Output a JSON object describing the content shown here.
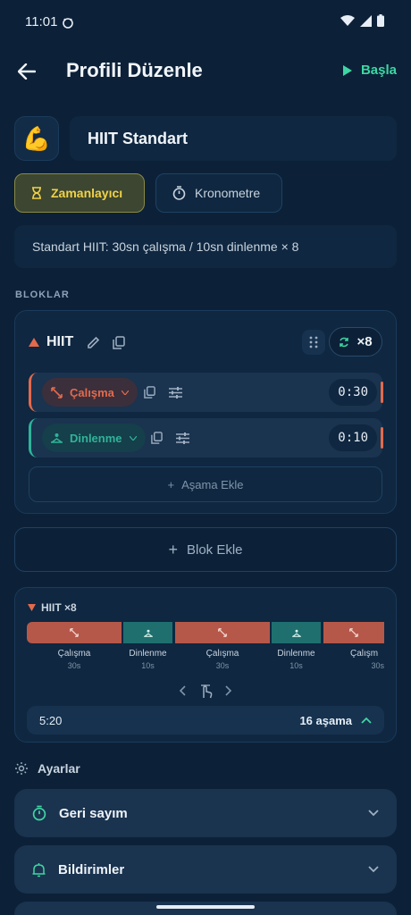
{
  "status": {
    "time": "11:01"
  },
  "header": {
    "title": "Profili Düzenle",
    "start_label": "Başla"
  },
  "profile": {
    "emoji": "💪",
    "name": "HIIT Standart",
    "description": "Standart HIIT: 30sn çalışma / 10sn dinlenme × 8"
  },
  "modes": {
    "timer": "Zamanlayıcı",
    "stopwatch": "Kronometre"
  },
  "section_blocks": "BLOKLAR",
  "block": {
    "name": "HIIT",
    "repeat": "×8",
    "phases": [
      {
        "label": "Çalışma",
        "time": "0:30",
        "type": "work"
      },
      {
        "label": "Dinlenme",
        "time": "0:10",
        "type": "rest"
      }
    ],
    "add_phase": "Aşama Ekle"
  },
  "add_block": "Blok Ekle",
  "preview": {
    "title": "HIIT ×8",
    "segments": [
      {
        "label": "Çalışma",
        "duration": "30s",
        "type": "work"
      },
      {
        "label": "Dinlenme",
        "duration": "10s",
        "type": "rest"
      },
      {
        "label": "Çalışma",
        "duration": "30s",
        "type": "work"
      },
      {
        "label": "Dinlenme",
        "duration": "10s",
        "type": "rest"
      },
      {
        "label": "Çalışm",
        "duration": "30s",
        "type": "work"
      }
    ],
    "total_time": "5:20",
    "phase_count": "16 aşama"
  },
  "settings": {
    "label": "Ayarlar",
    "items": [
      {
        "label": "Geri sayım",
        "icon": "stopwatch-icon"
      },
      {
        "label": "Bildirimler",
        "icon": "bell-icon"
      }
    ]
  },
  "colors": {
    "work": "#b5584a",
    "rest": "#1f6f6f",
    "accent": "#3ed6a3",
    "timer": "#f0d24a"
  }
}
